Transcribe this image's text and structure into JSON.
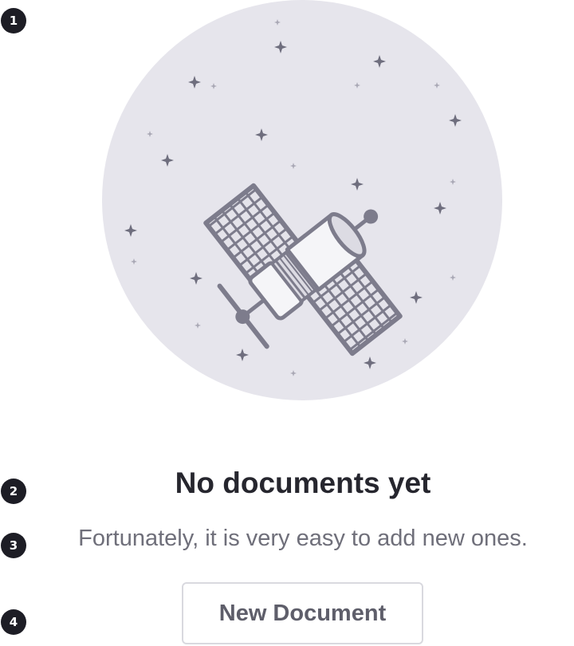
{
  "callouts": [
    "1",
    "2",
    "3",
    "4"
  ],
  "empty_state": {
    "illustration": "satellite-in-space-illustration",
    "title": "No documents yet",
    "subtitle": "Fortunately, it is very easy to add new ones.",
    "button_label": "New Document"
  },
  "colors": {
    "circle_bg": "#e6e5ec",
    "star": "#6f6e7e",
    "title": "#26262e",
    "subtitle": "#6f6f7a",
    "button_border": "#d9d9df",
    "button_text": "#5e5e6a",
    "callout_bg": "#1d1d25"
  }
}
